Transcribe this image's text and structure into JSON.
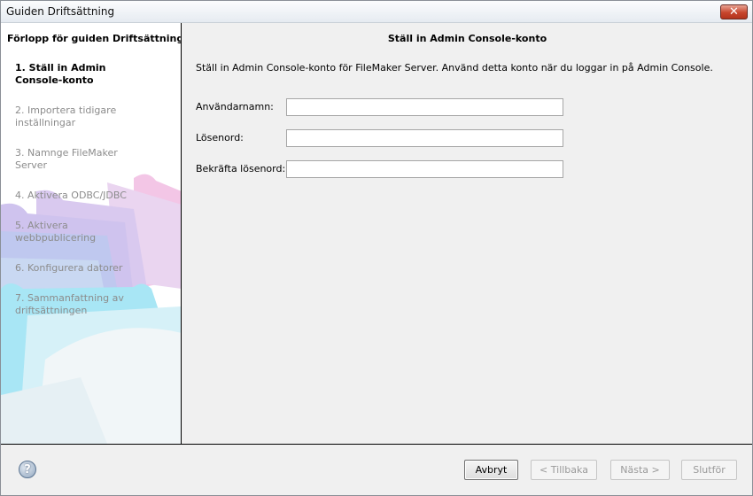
{
  "window": {
    "title": "Guiden Driftsättning",
    "close_glyph": "✕"
  },
  "sidebar": {
    "heading": "Förlopp för guiden Driftsättning",
    "steps": [
      {
        "label": "1. Ställ in Admin Console-konto",
        "active": true
      },
      {
        "label": "2. Importera tidigare inställningar",
        "active": false
      },
      {
        "label": "3. Namnge FileMaker Server",
        "active": false
      },
      {
        "label": "4. Aktivera ODBC/JDBC",
        "active": false
      },
      {
        "label": "5. Aktivera webbpublicering",
        "active": false
      },
      {
        "label": "6. Konfigurera datorer",
        "active": false
      },
      {
        "label": "7. Sammanfattning av driftsättningen",
        "active": false
      }
    ]
  },
  "main": {
    "heading": "Ställ in Admin Console-konto",
    "description": "Ställ in Admin Console-konto för FileMaker Server. Använd detta konto när du loggar in på Admin Console.",
    "fields": {
      "username_label": "Användarnamn:",
      "username_value": "",
      "password_label": "Lösenord:",
      "password_value": "",
      "confirm_label": "Bekräfta lösenord:",
      "confirm_value": ""
    }
  },
  "footer": {
    "help_glyph": "?",
    "cancel_label": "Avbryt",
    "back_label": "< Tillbaka",
    "next_label": "Nästa >",
    "finish_label": "Slutför"
  },
  "icons": {
    "close": "close-icon",
    "help": "help-icon"
  }
}
